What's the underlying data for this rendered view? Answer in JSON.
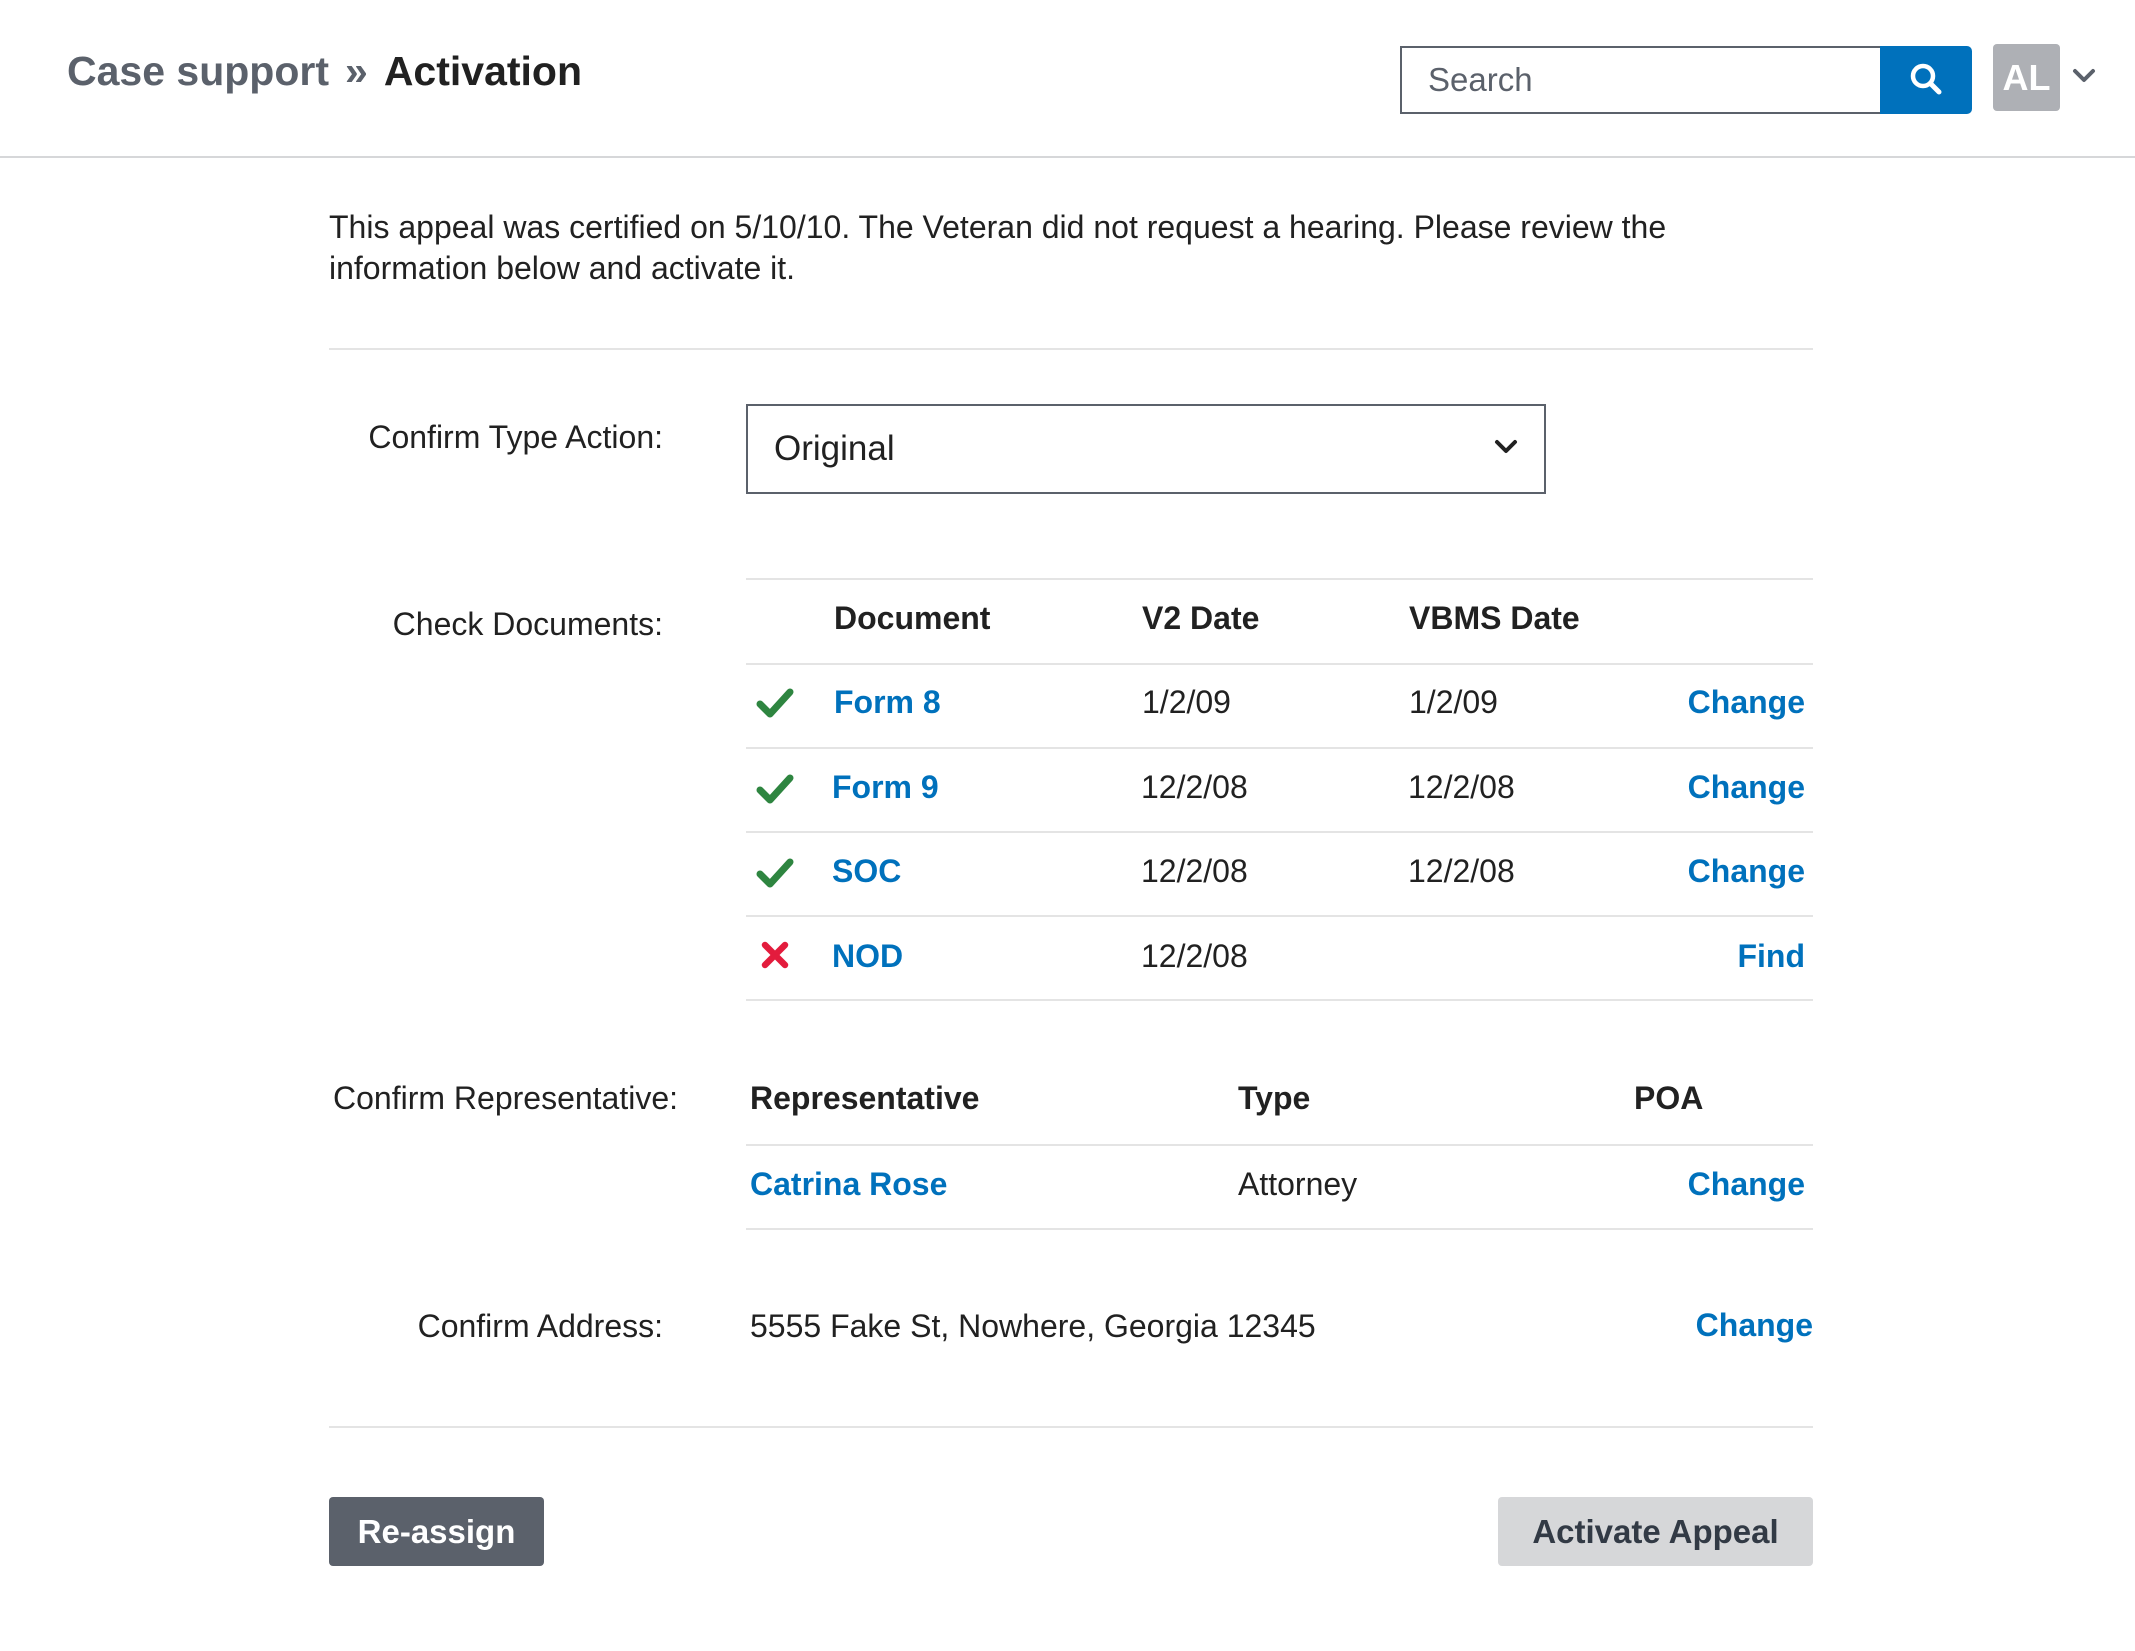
{
  "header": {
    "breadcrumb": {
      "parent": "Case support",
      "separator": "»",
      "current": "Activation"
    },
    "search": {
      "placeholder": "Search",
      "value": "",
      "icon": "search-icon"
    },
    "user": {
      "initials": "AL",
      "menu_icon": "chevron-down-icon"
    }
  },
  "intro": {
    "text": "This appeal was certified on 5/10/10. The Veteran did not request a hearing. Please review the information below and activate it."
  },
  "type_action": {
    "label": "Confirm Type Action:",
    "selected": "Original"
  },
  "documents": {
    "label": "Check Documents:",
    "columns": [
      "Document",
      "V2 Date",
      "VBMS Date"
    ],
    "rows": [
      {
        "status": "ok",
        "status_icon": "check-icon",
        "name": "Form 8",
        "v2_date": "1/2/09",
        "vbms_date": "1/2/09",
        "action": "Change"
      },
      {
        "status": "ok",
        "status_icon": "check-icon",
        "name": "Form 9",
        "v2_date": "12/2/08",
        "vbms_date": "12/2/08",
        "action": "Change"
      },
      {
        "status": "ok",
        "status_icon": "check-icon",
        "name": "SOC",
        "v2_date": "12/2/08",
        "vbms_date": "12/2/08",
        "action": "Change"
      },
      {
        "status": "missing",
        "status_icon": "x-icon",
        "name": "NOD",
        "v2_date": "12/2/08",
        "vbms_date": "",
        "action": "Find"
      }
    ]
  },
  "representative": {
    "label": "Confirm Representative:",
    "columns": [
      "Representative",
      "Type",
      "POA"
    ],
    "rows": [
      {
        "name": "Catrina Rose",
        "type": "Attorney",
        "action": "Change"
      }
    ]
  },
  "address": {
    "label": "Confirm Address:",
    "value": "5555 Fake St, Nowhere, Georgia 12345",
    "action": "Change"
  },
  "actions": {
    "reassign": "Re-assign",
    "activate": "Activate Appeal"
  },
  "colors": {
    "primary": "#0071bc",
    "success": "#2e8540",
    "error": "#e31c3d",
    "secondary_button": "#5b616b",
    "disabled_button": "#d6d7d9"
  }
}
